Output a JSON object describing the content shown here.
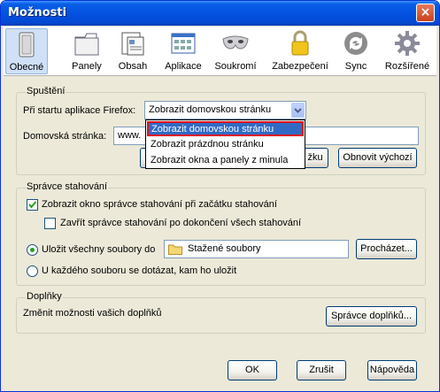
{
  "window": {
    "title": "Možnosti",
    "close_label": "×"
  },
  "toolbar": {
    "tabs": [
      {
        "label": "Obecné",
        "icon": "general-icon"
      },
      {
        "label": "Panely",
        "icon": "tabs-icon"
      },
      {
        "label": "Obsah",
        "icon": "content-icon"
      },
      {
        "label": "Aplikace",
        "icon": "applications-icon"
      },
      {
        "label": "Soukromí",
        "icon": "privacy-mask-icon"
      },
      {
        "label": "Zabezpečení",
        "icon": "padlock-icon"
      },
      {
        "label": "Sync",
        "icon": "sync-icon"
      },
      {
        "label": "Rozšířené",
        "icon": "gear-icon"
      }
    ],
    "active": "Obecné"
  },
  "startup": {
    "group_title": "Spuštění",
    "label": "Při startu aplikace Firefox:",
    "selected": "Zobrazit domovskou stránku",
    "options": [
      "Zobrazit domovskou stránku",
      "Zobrazit prázdnou stránku",
      "Zobrazit okna a panely z minula"
    ],
    "homepage_label": "Domovská stránka:",
    "homepage_value": "www.",
    "use_bookmark_btn": "žku",
    "restore_default_btn": "Obnovit výchozí"
  },
  "downloads": {
    "group_title": "Správce stahování",
    "show_manager_label": "Zobrazit okno správce stahování při začátku stahování",
    "show_manager_checked": true,
    "close_manager_label": "Zavřít správce stahování po dokončení všech stahování",
    "close_manager_checked": false,
    "save_to_label": "Uložit všechny soubory do",
    "folder_name": "Stažené soubory",
    "browse_btn": "Procházet...",
    "ask_label": "U každého souboru se dotázat, kam ho uložit",
    "selected_option": "save_to"
  },
  "addons": {
    "group_title": "Doplňky",
    "description": "Změnit možnosti vašich doplňků",
    "manage_btn": "Správce doplňků..."
  },
  "footer": {
    "ok": "OK",
    "cancel": "Zrušit",
    "help": "Nápověda"
  },
  "colors": {
    "titlebar": "#0352e0",
    "dialog_bg": "#ece9d8",
    "selection": "#316ac5",
    "highlight_border": "#e0101a"
  }
}
